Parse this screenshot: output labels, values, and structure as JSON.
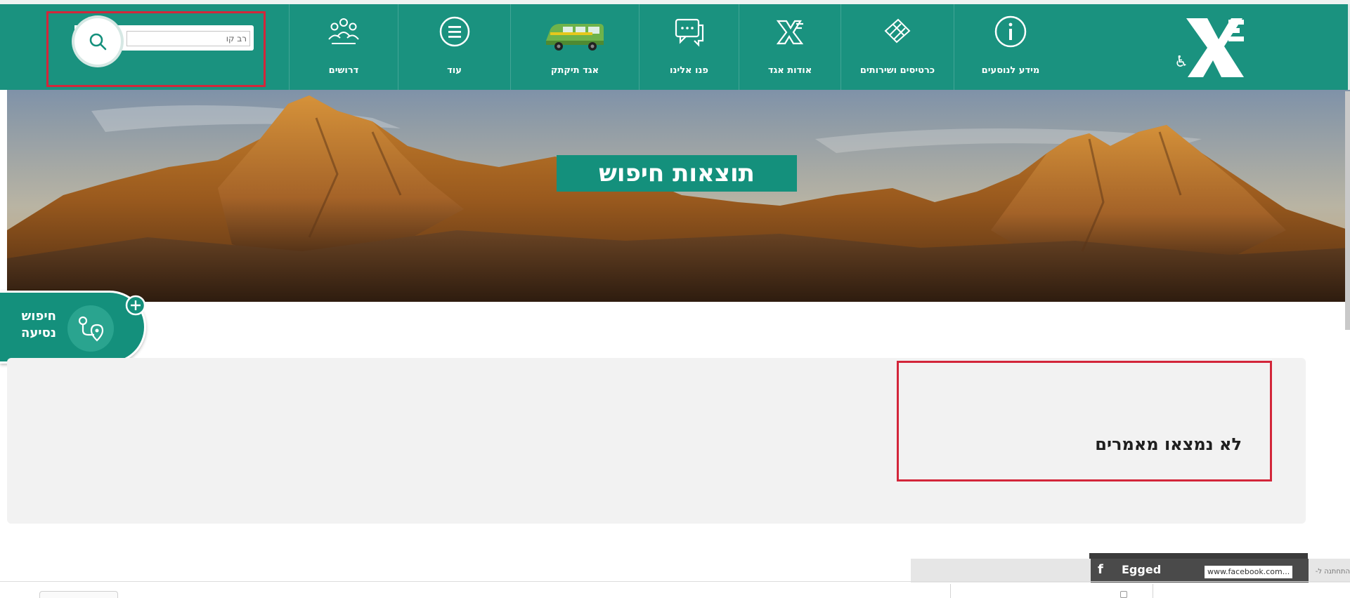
{
  "header": {
    "nav_items": [
      {
        "label": "מידע לנוסעים",
        "icon": "info-icon"
      },
      {
        "label": "כרטיסים ושירותים",
        "icon": "tickets-icon"
      },
      {
        "label": "אודות אגד",
        "icon": "egged-x-icon"
      },
      {
        "label": "פנו אלינו",
        "icon": "chat-icon"
      },
      {
        "label": "אגד תיקתק",
        "icon": "minibus-icon"
      },
      {
        "label": "עוד",
        "icon": "menu-icon"
      },
      {
        "label": "דרושים",
        "icon": "people-icon"
      }
    ],
    "search": {
      "value": "רב קו"
    },
    "logo": {
      "name": "egged-logo",
      "brand_color": "#1a927f"
    }
  },
  "banner": {
    "title": "תוצאות חיפוש"
  },
  "trip_search": {
    "label": "חיפוש נסיעה"
  },
  "results": {
    "empty_message": "לא נמצאו מאמרים"
  },
  "facebook": {
    "page_name": "Egged",
    "url_text": "www.facebook.com...",
    "hint": "התחתנה ל-"
  },
  "colors": {
    "accent": "#1a927f",
    "highlight_border": "#d3263a"
  }
}
